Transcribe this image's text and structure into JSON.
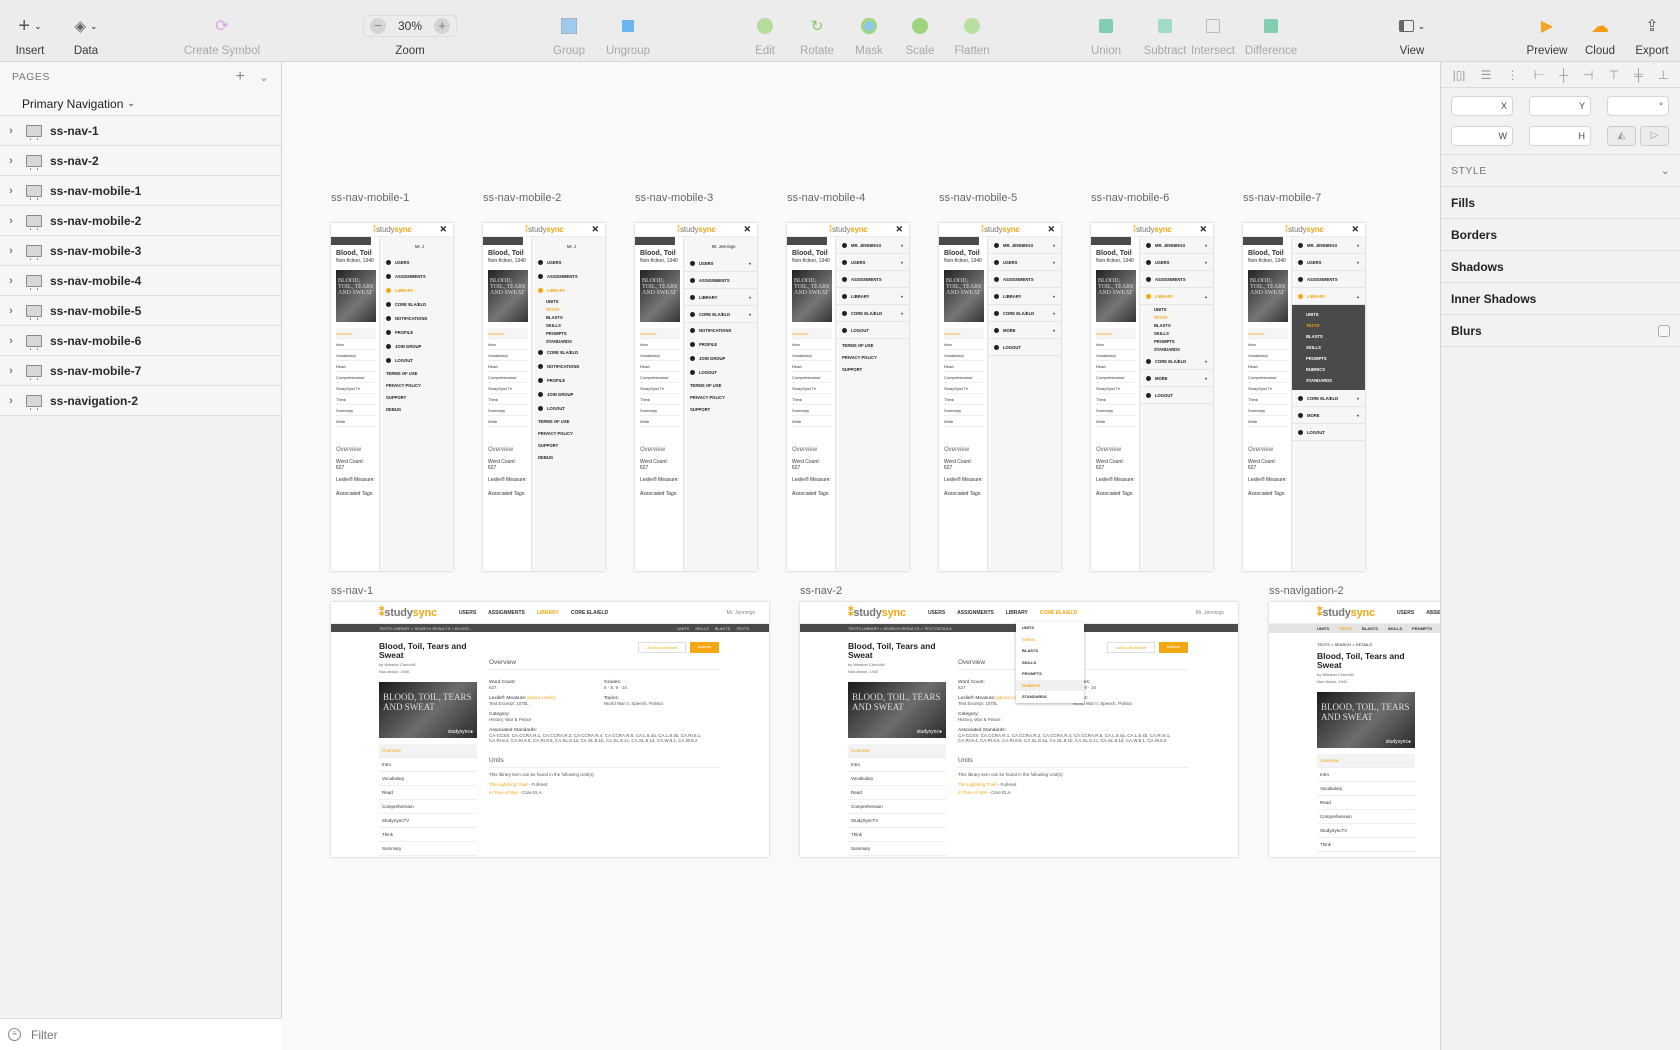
{
  "toolbar": {
    "insert": "Insert",
    "data": "Data",
    "create_symbol": "Create Symbol",
    "zoom": "Zoom",
    "zoom_value": "30%",
    "group": "Group",
    "ungroup": "Ungroup",
    "edit": "Edit",
    "rotate": "Rotate",
    "mask": "Mask",
    "scale": "Scale",
    "flatten": "Flatten",
    "union": "Union",
    "subtract": "Subtract",
    "intersect": "Intersect",
    "difference": "Difference",
    "view": "View",
    "preview": "Preview",
    "cloud": "Cloud",
    "export": "Export"
  },
  "pages": {
    "header": "PAGES",
    "current": "Primary Navigation",
    "layers": [
      "ss-nav-1",
      "ss-nav-2",
      "ss-nav-mobile-1",
      "ss-nav-mobile-2",
      "ss-nav-mobile-3",
      "ss-nav-mobile-4",
      "ss-nav-mobile-5",
      "ss-nav-mobile-6",
      "ss-nav-mobile-7",
      "ss-navigation-2"
    ],
    "filter_placeholder": "Filter"
  },
  "inspector": {
    "x": "X",
    "y": "Y",
    "rotation": "°",
    "w": "W",
    "h": "H",
    "style": "STYLE",
    "sections": [
      "Fills",
      "Borders",
      "Shadows",
      "Inner Shadows",
      "Blurs"
    ]
  },
  "design": {
    "logo_a": "study",
    "logo_b": "sync",
    "title_short": "Blood, Toil",
    "title": "Blood, Toil, Tears and Sweat",
    "by": "by Winston Churchill",
    "meta": "Non-fiction, 1940",
    "cover_text": "BLOOD, TOIL, TEARS AND SWEAT",
    "side_nav": [
      "Overview",
      "Intro",
      "Vocabulary",
      "Read",
      "Comprehension",
      "StudySyncTV",
      "Think",
      "Summary",
      "Write"
    ],
    "top_nav": [
      "USERS",
      "ASSIGNMENTS",
      "LIBRARY",
      "CORE ELA/ELD"
    ],
    "user": "Mr. Jennings",
    "breadcrumb1": "TEXTS LIBRARY > SEARCH RESULTS > BLOOD...",
    "breadcrumb2": "TEXTS LIBRARY > SEARCH RESULTS > TEXT DETAILS",
    "breadcrumb3": "TEXTS > SEARCH > DETAILS",
    "sub_nav": [
      "UNITS",
      "SKILLS",
      "BLASTS",
      "TEXTS"
    ],
    "sub_nav2": [
      "UNITS",
      "TEXTS",
      "BLASTS",
      "SKILLS",
      "PROMPTS"
    ],
    "dropdown": [
      "UNITS",
      "TEXTS",
      "BLASTS",
      "SKILLS",
      "PROMPTS",
      "RUBRICS",
      "STANDARDS"
    ],
    "add_bookshelf": "Add to bookshelf",
    "actions": "Actions",
    "overview": "Overview",
    "word_count_l": "Word Count:",
    "word_count": "627",
    "grades_l": "Grades:",
    "grades": "6 - 8, 9 - 10",
    "lexile_l": "Lexile® Measure:",
    "lexile_link": "(about Lexile)",
    "lexile": "Text Excerpt: 1070L",
    "topics_l": "Topics:",
    "topics": "World War II, Speech, Politics",
    "category_l": "Category:",
    "category": "History, War & Peace",
    "standards_l": "Associated Standards:",
    "standards": "CA-CCSS: CA.CCRA.R.1, CA.CCRA.R.2, CA.CCRA.R.4, CA.CCRA.R.6, CA.L.8.4a, CA.L.8.4b, CA.RI.8.1, CA.RI.8.4, CA.RI.8.6, CA.RI.8.8, CA.SL.8.1a, CA.SL.8.1b, CA.SL.8.1c, CA.SL.8.1d, CA.W.8.1, CA.W.8.2",
    "units_h": "Units",
    "units_text": "This library item can be found in the following Unit(s):",
    "unit1": "The Lightning Thief",
    "unit1b": " - Full-text",
    "unit2": "In Time of War",
    "unit2b": " - Core ELA",
    "tags_l": "Associated Tags"
  },
  "artboards": [
    {
      "name": "ss-nav-mobile-1"
    },
    {
      "name": "ss-nav-mobile-2"
    },
    {
      "name": "ss-nav-mobile-3"
    },
    {
      "name": "ss-nav-mobile-4"
    },
    {
      "name": "ss-nav-mobile-5"
    },
    {
      "name": "ss-nav-mobile-6"
    },
    {
      "name": "ss-nav-mobile-7"
    },
    {
      "name": "ss-nav-1"
    },
    {
      "name": "ss-nav-2"
    },
    {
      "name": "ss-navigation-2"
    }
  ],
  "menus": {
    "m1": {
      "user": "Mr. J",
      "items": [
        "USERS",
        "ASSIGNMENTS",
        "LIBRARY",
        "CORE ELA/ELD",
        "NOTIFICATIONS",
        "PROFILE",
        "JOIN GROUP",
        "LOGOUT"
      ],
      "links": [
        "TERMS OF USE",
        "PRIVACY POLICY",
        "SUPPORT",
        "DEBUG"
      ]
    },
    "m2": {
      "user": "Mr. J",
      "items": [
        "USERS",
        "ASSIGNMENTS",
        "LIBRARY"
      ],
      "subs": [
        "UNITS",
        "TEXTS",
        "BLASTS",
        "SKILLS",
        "PROMPTS",
        "STANDARDS"
      ],
      "items2": [
        "CORE ELA/ELD",
        "NOTIFICATIONS",
        "PROFILE",
        "JOIN GROUP",
        "LOGOUT"
      ],
      "links": [
        "TERMS OF USE",
        "PRIVACY POLICY",
        "SUPPORT",
        "DEBUG"
      ]
    },
    "m3": {
      "user": "Mr. Jennings",
      "items": [
        "USERS",
        "ASSIGNMENTS",
        "LIBRARY",
        "CORE ELA/ELD"
      ],
      "items2": [
        "NOTIFICATIONS",
        "PROFILE",
        "JOIN GROUP",
        "LOGOUT"
      ],
      "links": [
        "TERMS OF USE",
        "PRIVACY POLICY",
        "SUPPORT"
      ]
    },
    "m4": {
      "items": [
        "MR. JENNINGS",
        "USERS",
        "ASSIGNMENTS",
        "LIBRARY",
        "CORE ELA/ELD",
        "LOGOUT"
      ],
      "links": [
        "TERMS OF USE",
        "PRIVACY POLICY",
        "SUPPORT"
      ]
    },
    "m5": {
      "items": [
        "MR. JENNINGS",
        "USERS",
        "ASSIGNMENTS",
        "LIBRARY",
        "CORE ELA/ELD",
        "MORE",
        "LOGOUT"
      ]
    },
    "m6": {
      "items": [
        "MR. JENNINGS",
        "USERS",
        "ASSIGNMENTS",
        "LIBRARY"
      ],
      "subs": [
        "UNITS",
        "TEXTS",
        "BLASTS",
        "SKILLS",
        "PROMPTS",
        "STANDARDS"
      ],
      "items2": [
        "CORE ELA/ELD",
        "MORE",
        "LOGOUT"
      ]
    },
    "m7": {
      "items": [
        "MR. JENNINGS",
        "USERS",
        "ASSIGNMENTS",
        "LIBRARY"
      ],
      "subs": [
        "UNITS",
        "TEXTS",
        "BLASTS",
        "SKILLS",
        "PROMPTS",
        "RUBRICS",
        "STANDARDS"
      ],
      "items2": [
        "CORE ELA/ELD",
        "MORE",
        "LOGOUT"
      ]
    }
  },
  "colors": {
    "accent": "#f3a712",
    "dark_bar": "#4a4a4a"
  }
}
